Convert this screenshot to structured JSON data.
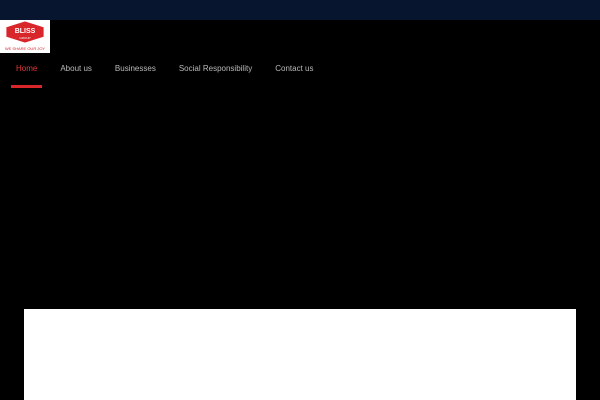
{
  "colors": {
    "top_bar": "#07152e",
    "background": "#000000",
    "nav_text": "#b9b9b9",
    "nav_active": "#e23a3a",
    "nav_underline": "#d8262b",
    "logo_red": "#d8262b",
    "panel": "#ffffff"
  },
  "logo": {
    "brand": "BLISS",
    "sub": "GROUP",
    "tagline": "WE SHARE OUR JOY"
  },
  "nav": {
    "items": [
      {
        "label": "Home",
        "active": true
      },
      {
        "label": "About us",
        "active": false
      },
      {
        "label": "Businesses",
        "active": false
      },
      {
        "label": "Social Responsibility",
        "active": false
      },
      {
        "label": "Contact us",
        "active": false
      }
    ]
  }
}
